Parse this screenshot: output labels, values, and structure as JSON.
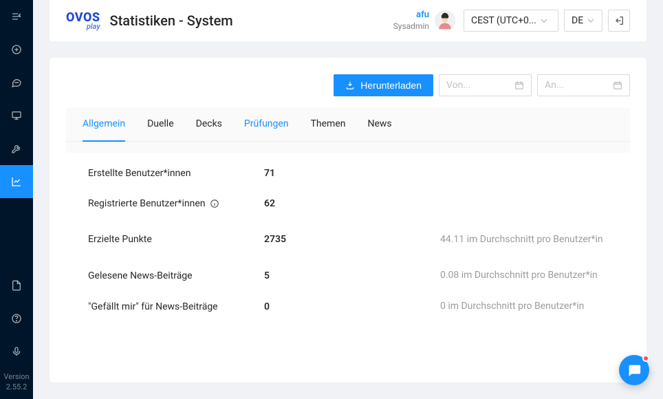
{
  "sidebar": {
    "version_label": "Version",
    "version_value": "2.55.2"
  },
  "header": {
    "logo_main": "OVOS",
    "logo_sub": "play",
    "title": "Statistiken - System",
    "user_name": "afu",
    "user_role": "Sysadmin",
    "timezone": "CEST (UTC+0...",
    "language": "DE"
  },
  "toolbar": {
    "download_label": "Herunterladen",
    "date_from_placeholder": "Von...",
    "date_to_placeholder": "An..."
  },
  "tabs": [
    {
      "label": "Allgemein",
      "active": true
    },
    {
      "label": "Duelle"
    },
    {
      "label": "Decks"
    },
    {
      "label": "Prüfungen",
      "highlight": true
    },
    {
      "label": "Themen"
    },
    {
      "label": "News"
    }
  ],
  "stats": [
    {
      "label": "Erstellte Benutzer*innen",
      "value": "71",
      "extra": ""
    },
    {
      "label": "Registrierte Benutzer*innen",
      "value": "62",
      "extra": "",
      "info": true
    },
    {
      "label": "Erzielte Punkte",
      "value": "2735",
      "extra": "44.11 im Durchschnitt pro Benutzer*in",
      "tall": true
    },
    {
      "label": "Gelesene News-Beiträge",
      "value": "5",
      "extra": "0.08 im Durchschnitt pro Benutzer*in"
    },
    {
      "label": "\"Gefällt mir\" für News-Beiträge",
      "value": "0",
      "extra": "0 im Durchschnitt pro Benutzer*in"
    }
  ]
}
